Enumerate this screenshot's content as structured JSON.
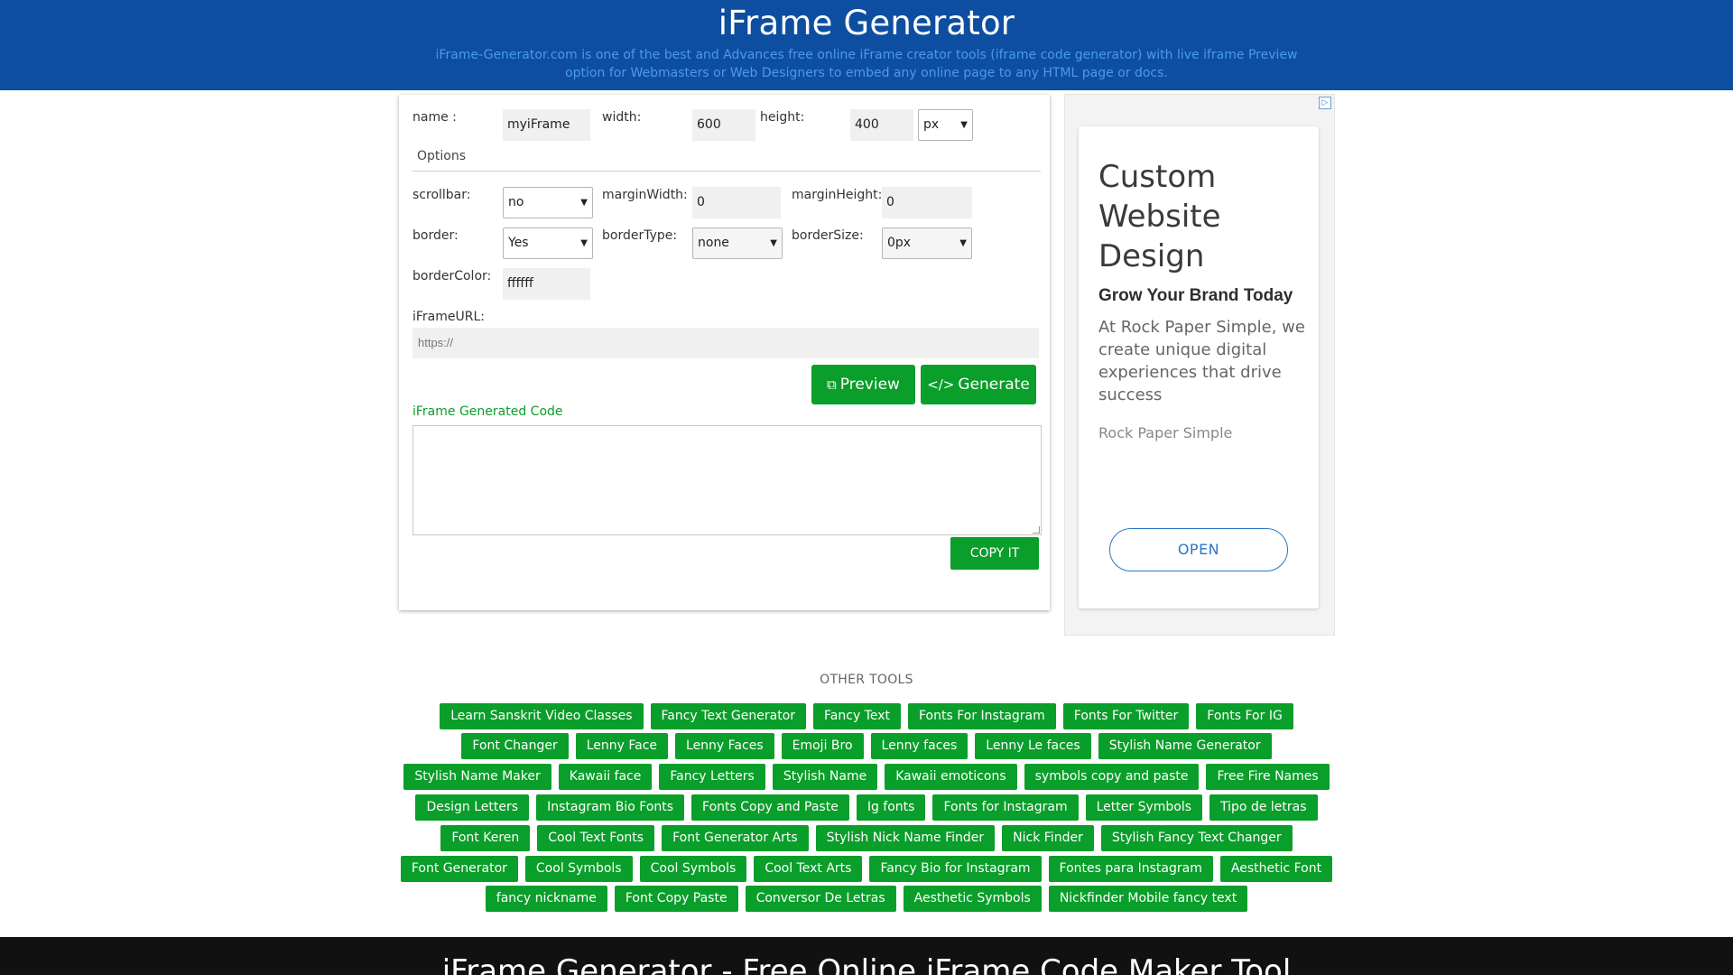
{
  "header": {
    "title": "iFrame Generator",
    "description": "iFrame-Generator.com is one of the best and Advances free online iFrame creator tools (iframe code generator) with live iframe Preview option for Webmasters or Web Designers to embed any online page to any HTML page or docs."
  },
  "form": {
    "name_label": "name :",
    "name_value": "myiFrame",
    "width_label": "width:",
    "width_value": "600",
    "height_label": "height:",
    "height_value": "400",
    "unit_value": "px",
    "options_label": "Options",
    "scrollbar_label": "scrollbar:",
    "scrollbar_value": "no",
    "marginwidth_label": "marginWidth:",
    "marginwidth_value": "0",
    "marginheight_label": "marginHeight:",
    "marginheight_value": "0",
    "border_label": "border:",
    "border_value": "Yes",
    "bordertype_label": "borderType:",
    "bordertype_value": "none",
    "bordersize_label": "borderSize:",
    "bordersize_value": "0px",
    "bordercolor_label": "borderColor:",
    "bordercolor_value": "ffffff",
    "url_label": "iFrameURL:",
    "url_placeholder": "https://",
    "preview_label": "Preview",
    "generate_label": "Generate",
    "generated_code_label": "iFrame Generated Code",
    "copy_label": "COPY IT"
  },
  "ad": {
    "headline": "Custom Website Design",
    "subheadline": "Grow Your Brand Today",
    "body": "At Rock Paper Simple, we create unique digital experiences that drive success",
    "brand": "Rock Paper Simple",
    "cta": "OPEN",
    "choice_icon": "adchoices-icon"
  },
  "other_tools": {
    "title": "OTHER TOOLS",
    "rows": [
      [
        "Learn Sanskrit Video Classes",
        "Fancy Text Generator",
        "Fancy Text",
        "Fonts For Instagram",
        "Fonts For Twitter",
        "Fonts For IG"
      ],
      [
        "Font Changer",
        "Lenny Face",
        "Lenny Faces",
        "Emoji Bro",
        "Lenny faces",
        "Lenny Le faces",
        "Stylish Name Generator"
      ],
      [
        "Stylish Name Maker",
        "Kawaii face",
        "Fancy Letters",
        "Stylish Name",
        "Kawaii emoticons",
        "symbols copy and paste",
        "Free Fire Names"
      ],
      [
        "Design Letters",
        "Instagram Bio Fonts",
        "Fonts Copy and Paste",
        "Ig fonts",
        "Fonts for Instagram",
        "Letter Symbols",
        "Tipo de letras"
      ],
      [
        "Font Keren",
        "Cool Text Fonts",
        "Font Generator Arts",
        "Stylish Nick Name Finder",
        "Nick Finder",
        "Stylish Fancy Text Changer"
      ],
      [
        "Font Generator",
        "Cool Symbols",
        "Cool Symbols",
        "Cool Text Arts",
        "Fancy Bio for Instagram",
        "Fontes para Instagram",
        "Aesthetic Font"
      ],
      [
        "fancy nickname",
        "Font Copy Paste",
        "Conversor De Letras",
        "Aesthetic Symbols",
        "Nickfinder Mobile fancy text"
      ]
    ]
  },
  "footer": {
    "title": "iFrame Generator - Free Online iFrame Code Maker Tool"
  },
  "colors": {
    "header_bg": "#0d4ea1",
    "accent_green": "#0a9e2a",
    "ad_link_blue": "#2a76c8"
  }
}
